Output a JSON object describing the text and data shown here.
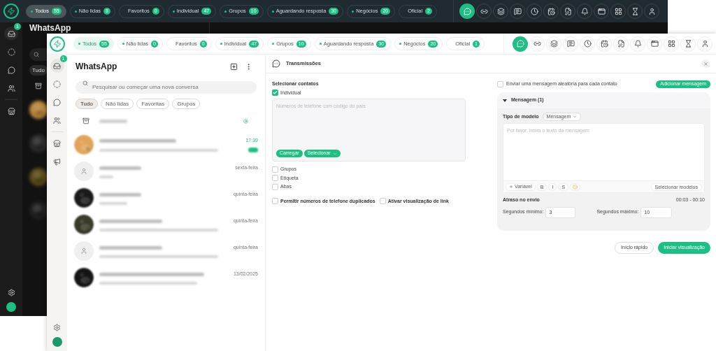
{
  "back": {
    "filters": [
      {
        "label": "Todos",
        "count": "55",
        "dot": true,
        "selected": true
      },
      {
        "label": "Não lidas",
        "count": "8",
        "dot": true,
        "selected": false
      },
      {
        "label": "Favoritos",
        "count": "0",
        "dot": false,
        "selected": false
      },
      {
        "label": "Individual",
        "count": "47",
        "dot": true,
        "selected": false
      },
      {
        "label": "Grupos",
        "count": "10",
        "dot": true,
        "selected": false
      },
      {
        "label": "Aguardando resposta",
        "count": "30",
        "dot": true,
        "selected": false
      },
      {
        "label": "Negócios",
        "count": "20",
        "dot": true,
        "selected": false
      },
      {
        "label": "Oficial",
        "count": "2",
        "dot": false,
        "selected": false
      }
    ],
    "tools": [
      {
        "selected": true
      },
      {
        "selected": false
      },
      {
        "selected": false
      },
      {
        "selected": false
      },
      {
        "selected": false
      },
      {
        "selected": false
      },
      {
        "selected": false
      },
      {
        "selected": false
      },
      {
        "selected": false
      },
      {
        "selected": false
      },
      {
        "selected": false
      },
      {
        "selected": false
      }
    ],
    "sidebar": [
      {
        "selected": true,
        "badge": "1"
      },
      {
        "selected": false
      },
      {
        "selected": false
      },
      {
        "selected": false
      },
      {
        "selected": false
      }
    ],
    "title": "WhatsApp",
    "chips": [
      {
        "label": "Tudo",
        "selected": true
      }
    ]
  },
  "front": {
    "filters": [
      {
        "label": "Todos",
        "count": "55",
        "dot": true,
        "selected": true
      },
      {
        "label": "Não lidas",
        "count": "0",
        "dot": true,
        "selected": false
      },
      {
        "label": "Favoritos",
        "count": "0",
        "dot": false,
        "selected": false
      },
      {
        "label": "Individual",
        "count": "47",
        "dot": true,
        "selected": false
      },
      {
        "label": "Grupos",
        "count": "10",
        "dot": true,
        "selected": false
      },
      {
        "label": "Aguardando resposta",
        "count": "30",
        "dot": true,
        "selected": false
      },
      {
        "label": "Negócios",
        "count": "20",
        "dot": true,
        "selected": false
      },
      {
        "label": "Oficial",
        "count": "1",
        "dot": false,
        "selected": false
      }
    ],
    "tools": [
      {
        "selected": true
      },
      {
        "selected": false
      },
      {
        "selected": false
      },
      {
        "selected": false
      },
      {
        "selected": false
      },
      {
        "selected": false
      },
      {
        "selected": false
      },
      {
        "selected": false
      },
      {
        "selected": false
      },
      {
        "selected": false
      },
      {
        "selected": false
      },
      {
        "selected": false
      }
    ],
    "sidebar": [
      {
        "selected": true,
        "badge": "1"
      },
      {
        "selected": false
      },
      {
        "selected": false
      },
      {
        "selected": false
      },
      {
        "selected": false
      },
      {
        "selected": false
      }
    ],
    "chat_panel": {
      "title": "WhatsApp",
      "search_placeholder": "Pesquisar ou começar uma nova conversa",
      "chips": [
        {
          "label": "Tudo",
          "selected": true
        },
        {
          "label": "Não lidas",
          "selected": false
        },
        {
          "label": "Favoritas",
          "selected": false
        },
        {
          "label": "Grupos",
          "selected": false
        }
      ],
      "chats": [
        {
          "time": "17:39",
          "unread": true
        },
        {
          "kind": "default",
          "time": "sexta-feira",
          "unread": false
        },
        {
          "time": "quinta-feira",
          "unread": false
        },
        {
          "time": "quinta-feira",
          "unread": false
        },
        {
          "kind": "default",
          "time": "quinta-feira",
          "unread": false
        },
        {
          "time": "13/02/2025",
          "unread": false
        }
      ]
    },
    "broadcast": {
      "title": "Transmissões",
      "select_label": "Selecionar contatos",
      "individual": {
        "label": "Individual",
        "checked": true
      },
      "phone_placeholder": "Números de telefone com código do país",
      "load_button": "Carregar",
      "select_button": "Selecionar",
      "sources": [
        {
          "label": "Grupos",
          "checked": false
        },
        {
          "label": "Etiqueta",
          "checked": false
        },
        {
          "label": "Abas",
          "checked": false
        }
      ],
      "options": [
        {
          "label": "Permitir números de telefone duplicados",
          "checked": false
        },
        {
          "label": "Ativar visualização de link",
          "checked": false
        }
      ],
      "random_message": {
        "label": "Enviar uma mensagem aleatória para cada contato",
        "checked": false
      },
      "add_message_button": "Adicionar mensagem",
      "message": {
        "title": "Mensagem (1)",
        "expanded": true,
        "template_label": "Tipo de modelo",
        "template_value": "Mensagem",
        "placeholder": "Por favor, insira o texto da mensagem",
        "variable_button": "Variável",
        "format_buttons": [
          "B",
          "I",
          "S"
        ],
        "templates_button": "Selecionar modelos"
      },
      "delay": {
        "title": "Atraso no envio",
        "range": "00:03 - 00:10",
        "min_label": "Segundos mínimo:",
        "min_value": "3",
        "max_label": "Segundos máximo:",
        "max_value": "10"
      },
      "quick_start_button": "Início rápido",
      "start_preview_button": "Iniciar visualização"
    }
  }
}
